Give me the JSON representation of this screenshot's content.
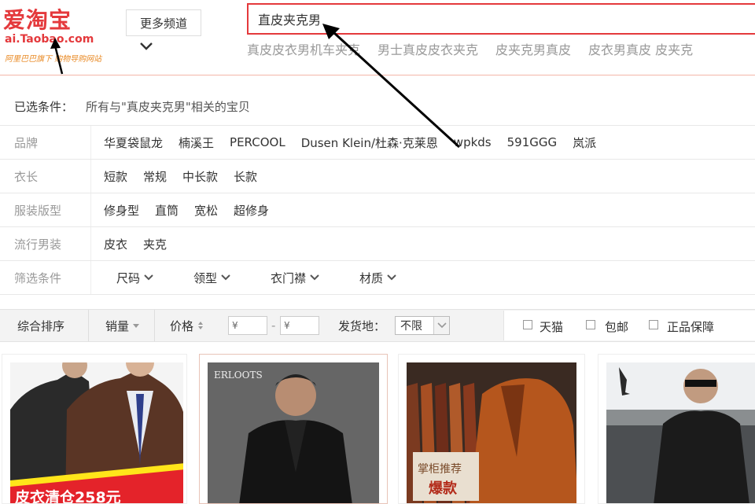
{
  "logo": {
    "main": "爱淘宝",
    "domain": "ai.Taobao.com",
    "slogan": "阿里巴巴旗下 购物导购网站"
  },
  "header": {
    "more_channels": "更多频道",
    "search_value": "直皮夹克男",
    "suggestions": [
      "真皮皮衣男机车夹克",
      "男士真皮皮衣夹克",
      "皮夹克男真皮",
      "皮衣男真皮 皮夹克"
    ]
  },
  "filters": {
    "selected_label": "已选条件：",
    "selected_value": "所有与\"真皮夹克男\"相关的宝贝",
    "rows": [
      {
        "label": "品牌",
        "values": [
          "华夏袋鼠龙",
          "楠溪王",
          "PERCOOL",
          "Dusen Klein/杜森·克莱恩",
          "wpkds",
          "591GGG",
          "岚派"
        ]
      },
      {
        "label": "衣长",
        "values": [
          "短款",
          "常规",
          "中长款",
          "长款"
        ]
      },
      {
        "label": "服装版型",
        "values": [
          "修身型",
          "直筒",
          "宽松",
          "超修身"
        ]
      },
      {
        "label": "流行男装",
        "values": [
          "皮衣",
          "夹克"
        ]
      }
    ],
    "more": {
      "label": "筛选条件",
      "dropdowns": [
        "尺码",
        "领型",
        "衣门襟",
        "材质"
      ]
    }
  },
  "sortbar": {
    "comprehensive": "综合排序",
    "sales": "销量",
    "price": "价格",
    "price_min_placeholder": "¥",
    "price_max_placeholder": "¥",
    "dash": "-",
    "ship_from_label": "发货地：",
    "ship_from_value": "不限",
    "checkboxes": [
      "天猫",
      "包邮",
      "正品保障"
    ]
  },
  "products": [
    {
      "badge": "皮衣清仓258元"
    },
    {
      "brand": "ERLOOTS"
    },
    {
      "badge_top": "掌柜推荐",
      "badge_bottom": "爆款"
    },
    {}
  ],
  "colors": {
    "brand_red": "#e4393c",
    "muted_text": "#999999",
    "slogan_orange": "#e98a25"
  }
}
